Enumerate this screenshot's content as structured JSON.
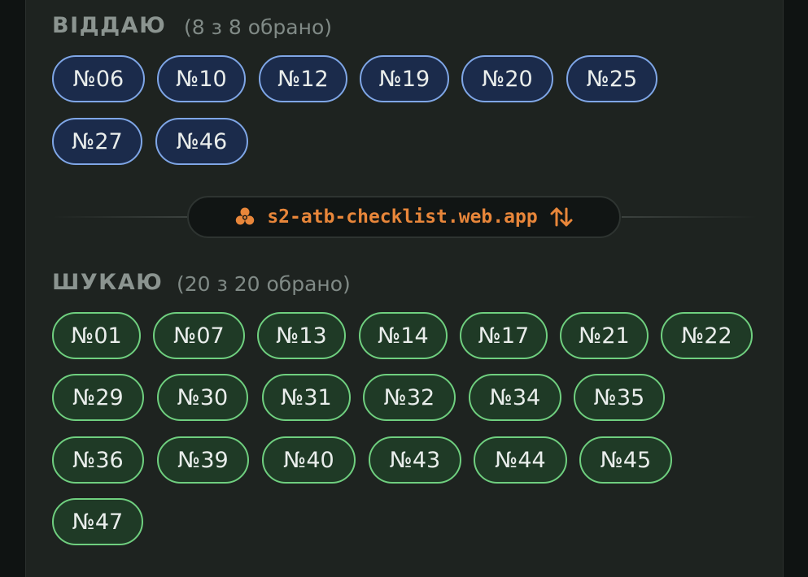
{
  "give": {
    "title": "ВІДДАЮ",
    "count": "(8 з 8 обрано)",
    "items": [
      "№06",
      "№10",
      "№12",
      "№19",
      "№20",
      "№25",
      "№27",
      "№46"
    ]
  },
  "link": {
    "icon": "biohazard-icon",
    "text": "s2-atb-checklist.web.app",
    "swap_icon": "swap-vertical-icon",
    "color": "#e8863a"
  },
  "want": {
    "title": "ШУКАЮ",
    "count": "(20 з 20 обрано)",
    "items": [
      "№01",
      "№07",
      "№13",
      "№14",
      "№17",
      "№21",
      "№22",
      "№29",
      "№30",
      "№31",
      "№32",
      "№34",
      "№35",
      "№36",
      "№39",
      "№40",
      "№43",
      "№44",
      "№45",
      "№47"
    ]
  },
  "colors": {
    "give_border": "#7fa6e6",
    "give_fill": "#1b2b4b",
    "want_border": "#6fcf7f",
    "want_fill": "#1f3a26",
    "card_bg": "#1e2320"
  }
}
